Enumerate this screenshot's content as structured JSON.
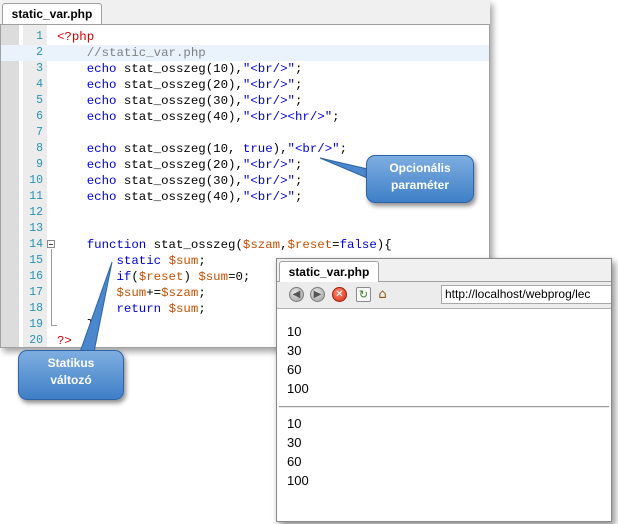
{
  "editor": {
    "tab_label": "static_var.php",
    "lines": [
      {
        "n": "1",
        "tokens": [
          {
            "c": "t-tag",
            "t": "<?php"
          }
        ]
      },
      {
        "n": "2",
        "tokens": [
          {
            "c": "t-txt",
            "t": "    "
          },
          {
            "c": "t-com",
            "t": "//static_var.php"
          }
        ]
      },
      {
        "n": "3",
        "tokens": [
          {
            "c": "t-txt",
            "t": "    "
          },
          {
            "c": "t-kw",
            "t": "echo"
          },
          {
            "c": "t-txt",
            "t": " stat_osszeg(10),"
          },
          {
            "c": "t-str",
            "t": "\"<br/>\""
          },
          {
            "c": "t-txt",
            "t": ";"
          }
        ]
      },
      {
        "n": "4",
        "tokens": [
          {
            "c": "t-txt",
            "t": "    "
          },
          {
            "c": "t-kw",
            "t": "echo"
          },
          {
            "c": "t-txt",
            "t": " stat_osszeg(20),"
          },
          {
            "c": "t-str",
            "t": "\"<br/>\""
          },
          {
            "c": "t-txt",
            "t": ";"
          }
        ]
      },
      {
        "n": "5",
        "tokens": [
          {
            "c": "t-txt",
            "t": "    "
          },
          {
            "c": "t-kw",
            "t": "echo"
          },
          {
            "c": "t-txt",
            "t": " stat_osszeg(30),"
          },
          {
            "c": "t-str",
            "t": "\"<br/>\""
          },
          {
            "c": "t-txt",
            "t": ";"
          }
        ]
      },
      {
        "n": "6",
        "tokens": [
          {
            "c": "t-txt",
            "t": "    "
          },
          {
            "c": "t-kw",
            "t": "echo"
          },
          {
            "c": "t-txt",
            "t": " stat_osszeg(40),"
          },
          {
            "c": "t-str",
            "t": "\"<br/><hr/>\""
          },
          {
            "c": "t-txt",
            "t": ";"
          }
        ]
      },
      {
        "n": "7",
        "tokens": []
      },
      {
        "n": "8",
        "tokens": [
          {
            "c": "t-txt",
            "t": "    "
          },
          {
            "c": "t-kw",
            "t": "echo"
          },
          {
            "c": "t-txt",
            "t": " stat_osszeg(10, "
          },
          {
            "c": "t-kw",
            "t": "true"
          },
          {
            "c": "t-txt",
            "t": "),"
          },
          {
            "c": "t-str",
            "t": "\"<br/>\""
          },
          {
            "c": "t-txt",
            "t": ";"
          }
        ]
      },
      {
        "n": "9",
        "tokens": [
          {
            "c": "t-txt",
            "t": "    "
          },
          {
            "c": "t-kw",
            "t": "echo"
          },
          {
            "c": "t-txt",
            "t": " stat_osszeg(20),"
          },
          {
            "c": "t-str",
            "t": "\"<br/>\""
          },
          {
            "c": "t-txt",
            "t": ";"
          }
        ]
      },
      {
        "n": "10",
        "tokens": [
          {
            "c": "t-txt",
            "t": "    "
          },
          {
            "c": "t-kw",
            "t": "echo"
          },
          {
            "c": "t-txt",
            "t": " stat_osszeg(30),"
          },
          {
            "c": "t-str",
            "t": "\"<br/>\""
          },
          {
            "c": "t-txt",
            "t": ";"
          }
        ]
      },
      {
        "n": "11",
        "tokens": [
          {
            "c": "t-txt",
            "t": "    "
          },
          {
            "c": "t-kw",
            "t": "echo"
          },
          {
            "c": "t-txt",
            "t": " stat_osszeg(40),"
          },
          {
            "c": "t-str",
            "t": "\"<br/>\""
          },
          {
            "c": "t-txt",
            "t": ";"
          }
        ]
      },
      {
        "n": "12",
        "tokens": []
      },
      {
        "n": "13",
        "tokens": []
      },
      {
        "n": "14",
        "tokens": [
          {
            "c": "t-txt",
            "t": "    "
          },
          {
            "c": "t-kw",
            "t": "function"
          },
          {
            "c": "t-txt",
            "t": " stat_osszeg("
          },
          {
            "c": "t-var",
            "t": "$szam"
          },
          {
            "c": "t-txt",
            "t": ","
          },
          {
            "c": "t-var",
            "t": "$reset"
          },
          {
            "c": "t-txt",
            "t": "="
          },
          {
            "c": "t-kw",
            "t": "false"
          },
          {
            "c": "t-txt",
            "t": "){"
          }
        ]
      },
      {
        "n": "15",
        "tokens": [
          {
            "c": "t-txt",
            "t": "        "
          },
          {
            "c": "t-kw",
            "t": "static"
          },
          {
            "c": "t-txt",
            "t": " "
          },
          {
            "c": "t-var",
            "t": "$sum"
          },
          {
            "c": "t-txt",
            "t": ";"
          }
        ]
      },
      {
        "n": "16",
        "tokens": [
          {
            "c": "t-txt",
            "t": "        "
          },
          {
            "c": "t-kw",
            "t": "if"
          },
          {
            "c": "t-txt",
            "t": "("
          },
          {
            "c": "t-var",
            "t": "$reset"
          },
          {
            "c": "t-txt",
            "t": ") "
          },
          {
            "c": "t-var",
            "t": "$sum"
          },
          {
            "c": "t-txt",
            "t": "=0;"
          }
        ]
      },
      {
        "n": "17",
        "tokens": [
          {
            "c": "t-txt",
            "t": "        "
          },
          {
            "c": "t-var",
            "t": "$sum"
          },
          {
            "c": "t-txt",
            "t": "+="
          },
          {
            "c": "t-var",
            "t": "$szam"
          },
          {
            "c": "t-txt",
            "t": ";"
          }
        ]
      },
      {
        "n": "18",
        "tokens": [
          {
            "c": "t-txt",
            "t": "        "
          },
          {
            "c": "t-kw",
            "t": "return"
          },
          {
            "c": "t-txt",
            "t": " "
          },
          {
            "c": "t-var",
            "t": "$sum"
          },
          {
            "c": "t-txt",
            "t": ";"
          }
        ]
      },
      {
        "n": "19",
        "tokens": [
          {
            "c": "t-txt",
            "t": "    }"
          }
        ]
      },
      {
        "n": "20",
        "tokens": [
          {
            "c": "t-tag",
            "t": "?>"
          }
        ]
      }
    ],
    "current_line": "2"
  },
  "callouts": {
    "optional_param": {
      "line1": "Opcionális",
      "line2": "paraméter"
    },
    "static_var": {
      "line1": "Statikus",
      "line2": "változó"
    }
  },
  "browser": {
    "tab_label": "static_var.php",
    "url": "http://localhost/webprog/lec",
    "output_block_1": [
      "10",
      "30",
      "60",
      "100"
    ],
    "output_block_2": [
      "10",
      "30",
      "60",
      "100"
    ],
    "icons": [
      "back-icon",
      "forward-icon",
      "stop-icon",
      "reload-icon",
      "home-icon"
    ]
  },
  "colors": {
    "callout_fill": "#4f8ed2",
    "keyword": "#0000d0",
    "variable": "#c05000",
    "php_tag": "#d00000",
    "comment": "#808080"
  }
}
